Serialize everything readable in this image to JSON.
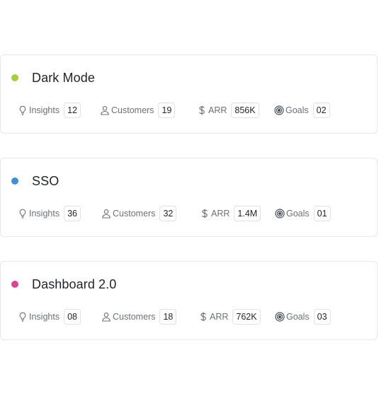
{
  "cards": [
    {
      "title": "Dark Mode",
      "dot_color": "#a3cf3e",
      "stats": {
        "insights": {
          "label": "Insights",
          "value": "12",
          "icon": "lightbulb-icon"
        },
        "customers": {
          "label": "Customers",
          "value": "19",
          "icon": "person-icon"
        },
        "arr": {
          "label": "ARR",
          "value": "856K",
          "icon": "dollar-icon"
        },
        "goals": {
          "label": "Goals",
          "value": "02",
          "icon": "target-icon"
        }
      }
    },
    {
      "title": "SSO",
      "dot_color": "#3f8fd2",
      "stats": {
        "insights": {
          "label": "Insights",
          "value": "36",
          "icon": "lightbulb-icon"
        },
        "customers": {
          "label": "Customers",
          "value": "32",
          "icon": "person-icon"
        },
        "arr": {
          "label": "ARR",
          "value": "1.4M",
          "icon": "dollar-icon"
        },
        "goals": {
          "label": "Goals",
          "value": "01",
          "icon": "target-icon"
        }
      }
    },
    {
      "title": "Dashboard 2.0",
      "dot_color": "#e0428f",
      "stats": {
        "insights": {
          "label": "Insights",
          "value": "08",
          "icon": "lightbulb-icon"
        },
        "customers": {
          "label": "Customers",
          "value": "18",
          "icon": "person-icon"
        },
        "arr": {
          "label": "ARR",
          "value": "762K",
          "icon": "dollar-icon"
        },
        "goals": {
          "label": "Goals",
          "value": "03",
          "icon": "target-icon"
        }
      }
    }
  ]
}
